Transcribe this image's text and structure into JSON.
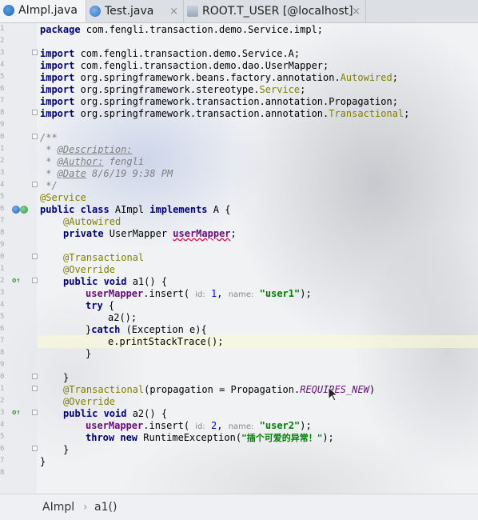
{
  "tabs": [
    {
      "label": "AImpl.java",
      "icon": "class-icon",
      "active": true
    },
    {
      "label": "Test.java",
      "icon": "class-icon",
      "active": false
    },
    {
      "label": "ROOT.T_USER [@localhost]",
      "icon": "table-icon",
      "active": false
    }
  ],
  "close_glyph": "×",
  "line_numbers": [
    "1",
    "2",
    "3",
    "4",
    "5",
    "6",
    "7",
    "8",
    "9",
    "0",
    "1",
    "2",
    "3",
    "4",
    "5",
    "6",
    "7",
    "8",
    "9",
    "0",
    "1",
    "2",
    "3",
    "4",
    "5",
    "6",
    "7",
    "8",
    "9",
    "0",
    "1",
    "2",
    "3",
    "4",
    "5",
    "6",
    "7",
    "8"
  ],
  "code": {
    "l1": {
      "kw": "package",
      "rest": " com.fengli.transaction.demo.Service.impl;"
    },
    "l3": {
      "kw": "import",
      "rest": " com.fengli.transaction.demo.Service.A;"
    },
    "l4": {
      "kw": "import",
      "rest": " com.fengli.transaction.demo.dao.UserMapper;"
    },
    "l5": {
      "kw": "import",
      "rest": " org.springframework.beans.factory.annotation.",
      "ann": "Autowired",
      "end": ";"
    },
    "l6": {
      "kw": "import",
      "rest": " org.springframework.stereotype.",
      "ann": "Service",
      "end": ";"
    },
    "l7": {
      "kw": "import",
      "rest": " org.springframework.transaction.annotation.Propagation;"
    },
    "l8": {
      "kw": "import",
      "rest": " org.springframework.transaction.annotation.",
      "ann": "Transactional",
      "end": ";"
    },
    "l10": {
      "text": "/**"
    },
    "l11": {
      "pre": " * ",
      "tag": "@Description:"
    },
    "l12": {
      "pre": " * ",
      "tag": "@Author:",
      "post": " fengli"
    },
    "l13": {
      "pre": " * ",
      "tag": "@Date",
      "post": " 8/6/19 9:38 PM"
    },
    "l14": {
      "text": " */"
    },
    "l15": {
      "ann": "@Service"
    },
    "l16": {
      "kw1": "public class",
      "mid": " AImpl ",
      "kw2": "implements",
      "end": " A {"
    },
    "l17": {
      "ann": "@Autowired"
    },
    "l18": {
      "kw": "private",
      "mid": " UserMapper ",
      "field": "userMapper",
      "end": ";"
    },
    "l20": {
      "ann": "@Transactional"
    },
    "l21": {
      "ann": "@Override"
    },
    "l22": {
      "kw": "public void",
      "end": " a1() {"
    },
    "l23": {
      "field": "userMapper",
      "mid": ".insert( ",
      "h1": "id:",
      "num": " 1",
      "c": ", ",
      "h2": "name:",
      "str": " \"user1\"",
      "end": ");"
    },
    "l24": {
      "kw": "try",
      "end": " {"
    },
    "l25": {
      "text": "a2();"
    },
    "l26": {
      "pre": "}",
      "kw": "catch",
      "end": " (Exception e){"
    },
    "l27": {
      "text": "e.printStackTrace();"
    },
    "l28": {
      "text": "}"
    },
    "l30": {
      "text": "}"
    },
    "l31": {
      "ann": "@Transactional",
      "mid": "(propagation = Propagation.",
      "static": "REQUIRES_NEW",
      "end": ")"
    },
    "l32": {
      "ann": "@Override"
    },
    "l33": {
      "kw": "public void",
      "end": " a2() {"
    },
    "l34": {
      "field": "userMapper",
      "mid": ".insert( ",
      "h1": "id:",
      "num": " 2",
      "c": ", ",
      "h2": "name:",
      "str": " \"user2\"",
      "end": ");"
    },
    "l35": {
      "kw": "throw new",
      "mid": " RuntimeException(",
      "str": "\"插个可爱的异常！\"",
      "end": ");"
    },
    "l36": {
      "text": "}"
    },
    "l37": {
      "text": "}"
    }
  },
  "breadcrumb": {
    "class": "AImpl",
    "sep": "›",
    "method": "a1()"
  },
  "colors": {
    "keyword": "#000080",
    "annotation": "#808000",
    "string": "#008000",
    "field": "#660e7a",
    "comment": "#808080",
    "number": "#0000ff"
  }
}
